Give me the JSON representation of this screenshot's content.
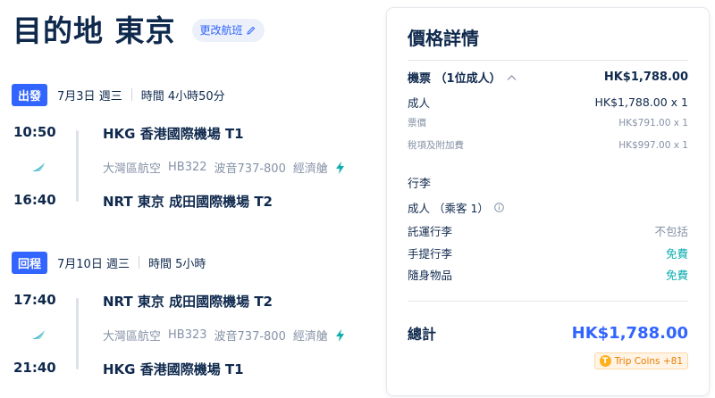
{
  "header": {
    "destination_title": "目的地 東京",
    "change_flight_label": "更改航班"
  },
  "segments": [
    {
      "badge": "出發",
      "date": "7月3日 週三",
      "duration": "時間 4小時50分",
      "dep_time": "10:50",
      "dep_airport": "HKG 香港國際機場 T1",
      "airline": "大灣區航空",
      "flight_no": "HB322",
      "aircraft": "波音737-800",
      "cabin": "經濟艙",
      "arr_time": "16:40",
      "arr_airport": "NRT 東京 成田國際機場 T2"
    },
    {
      "badge": "回程",
      "date": "7月10日 週三",
      "duration": "時間 5小時",
      "dep_time": "17:40",
      "dep_airport": "NRT 東京 成田國際機場 T2",
      "airline": "大灣區航空",
      "flight_no": "HB323",
      "aircraft": "波音737-800",
      "cabin": "經濟艙",
      "arr_time": "21:40",
      "arr_airport": "HKG 香港國際機場 T1"
    }
  ],
  "price_details": {
    "title": "價格詳情",
    "ticket_label": "機票 （1位成人）",
    "ticket_total": "HK$1,788.00",
    "adult_label": "成人",
    "adult_value": "HK$1,788.00 x 1",
    "fare_label": "票價",
    "fare_value": "HK$791.00 x 1",
    "tax_label": "稅項及附加費",
    "tax_value": "HK$997.00 x 1",
    "baggage_title": "行李",
    "passenger_label": "成人 （乘客 1）",
    "checked_label": "託運行李",
    "checked_value": "不包括",
    "carryon_label": "手提行李",
    "carryon_value": "免費",
    "personal_label": "隨身物品",
    "personal_value": "免費",
    "total_label": "總計",
    "total_value": "HK$1,788.00",
    "coins_label": "Trip Coins +81"
  },
  "colors": {
    "primary": "#3264ff",
    "text": "#0f294d",
    "muted": "#8592a6",
    "free": "#0eaeb1",
    "coins": "#ed7d00"
  },
  "icons": [
    "edit-icon",
    "airline-logo-icon",
    "bolt-icon",
    "chevron-up-icon",
    "info-icon",
    "trip-coin-icon"
  ]
}
